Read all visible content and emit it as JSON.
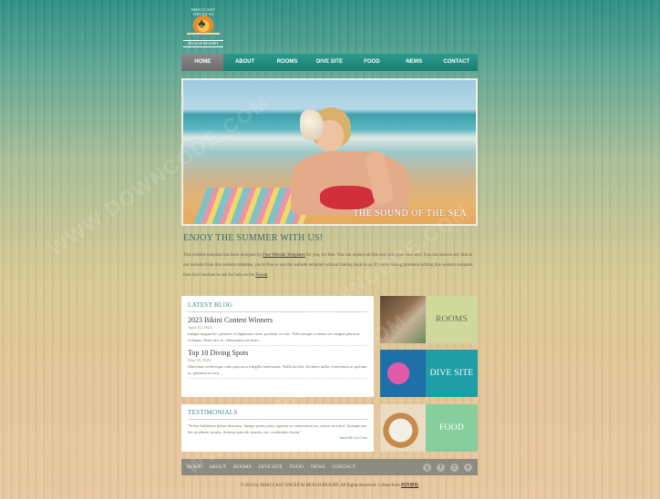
{
  "logo": {
    "ring_text": "BHACCASY ONCEZ'AI",
    "sub_text": "BEACH RESORT"
  },
  "nav": {
    "items": [
      "HOME",
      "ABOUT",
      "ROOMS",
      "DIVE SITE",
      "FOOD",
      "NEWS",
      "CONTACT"
    ],
    "active": "HOME"
  },
  "hero": {
    "caption": "THE SOUND OF THE SEA"
  },
  "welcome": {
    "title": "ENJOY THE SUMMER WITH US!",
    "text_before_link": "This website template has been designed by ",
    "link1": "Free Website Templates",
    "text_middle": " for you, for free. You can replace all this text with your own text. You can remove any link to our website from this website template, you're free to use this website template without linking back to us. If you're having problems editing this website template, then don't hesitate to ask for help on the ",
    "link2": "Forum",
    "text_end": "."
  },
  "blog": {
    "title": "LATEST BLOG",
    "posts": [
      {
        "title": "2023 Bikini Contest Winners",
        "date": "April 02, 2023",
        "text": "Integer magna leo, posuere et dignissim vitae, porttitor at odio. Pellentesque a metus nec magna placerat volutpat. Nunc nisi ac, elementum sit amet..."
      },
      {
        "title": "Top 10 Diving Spots",
        "date": "May 29, 2023",
        "text": "Maecenas scelerisque odio quis arcu fringilla malesuada. Nulla facilisi. In libero nulla, fermentum ut pretium ac, pharetra et arcu..."
      }
    ]
  },
  "testimonials": {
    "title": "TESTIMONIALS",
    "text": "\"In hac habitasse platea dictumst. Integer purus justo, egestas eu consectetur eu, cursus in tortor. Quisque nec leo ut ulteem iaculis. Aenean quis elit mauris, nec vestibulum lorem.\"",
    "author": "- Juan De La Cruz"
  },
  "features": {
    "rooms": "ROOMS",
    "dive_site": "DIVE SITE",
    "food": "FOOD"
  },
  "footer": {
    "links": [
      "HOME",
      "ABOUT",
      "ROOMS",
      "DIVE SITE",
      "FOOD",
      "NEWS",
      "CONTACT"
    ],
    "copyright_before": "© 2023 by BHACCASY ONCEZ'AI BEACH RESORT. All Rights Reserved. Collect from ",
    "copyright_link": "网页模板"
  },
  "watermark": "WWW.DOWNCODE.COM"
}
